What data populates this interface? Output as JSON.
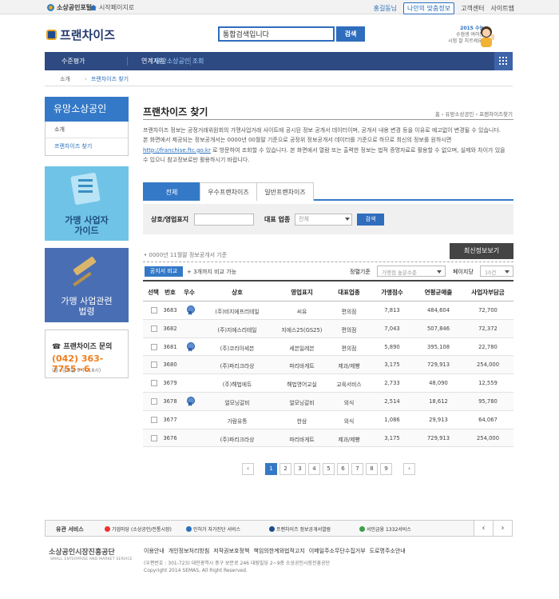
{
  "topbar": {
    "portal": "소상공인포털",
    "start_page": "시작페이지로",
    "lang": "홍길동님",
    "custom_info": "나만의 맞춤정보",
    "support": "고객센터",
    "sitemap": "사이트맵"
  },
  "header": {
    "brand": "프랜차이즈",
    "search_value": "통합검색입니다",
    "search_button": "검색",
    "promo_year": "2015 수능",
    "promo_l2": "수험생 여러분",
    "promo_l3": "시험 잘 치르세요!"
  },
  "nav": {
    "items": [
      "수준평가",
      "연계지원",
      "유망소상공인 조회"
    ]
  },
  "crumb": {
    "home": "소개",
    "current": "프랜차이즈 찾기"
  },
  "sidebar": {
    "title": "유망소상공인",
    "items": [
      "소개",
      "프랜차이즈 찾기"
    ],
    "banner1_l1": "가맹 사업자",
    "banner1_l2": "가이드",
    "banner2_l1": "가맹 사업관련",
    "banner2_l2": "법령",
    "contact_title": "프랜차이즈 문의",
    "contact_phone": "(042) 363-7755~6",
    "contact_hours": "(월~금요일 9시~18시)"
  },
  "page": {
    "title": "프랜차이즈 찾기",
    "location": "홈 › 유망소상공인 › 프랜차이즈찾기",
    "desc_1": "프랜차이즈 정보는 공정거래위원회의 가맹사업거래 사이트에 공시된 정보 공개서 데이터이며, 공개서 내용 변경 등을 이유로 예고없이 변경될 수 있습니다.  본 화면에서 제공되는 정보공개서는 0000년 00월말 기준으로 공정위 정보공개서 데이터를 기준으로 하므로 최신의 정보를 원하시면 ",
    "desc_link": "http://franchise.ftc.go.kr",
    "desc_2": " 로 방문하여 조회할 수 있습니다. 본 화면에서 열람 또는 출력한 정보는 법적 증명자료로 활용할 수 없으며, 실제와 차이가 있을 수 있으니 참고정보로만 활용하시기 바랍니다."
  },
  "tabs": [
    "전체",
    "우수프랜차이즈",
    "일반프랜차이즈"
  ],
  "filter": {
    "name_label": "상호/영업표지",
    "name_value": "",
    "industry_label": "대표 업종",
    "industry_value": "전체",
    "search_button": "검색"
  },
  "list": {
    "basis": "0000년 11월말 정보공개서 기준",
    "latest_button": "최신정보보기",
    "compare_button": "공지서 비교",
    "compare_note": "+ 3개까지 비교 가능",
    "sort_label": "정렬기준",
    "sort_value": "가맹점 높은수준",
    "page_label": "페이지당",
    "page_value": "10건",
    "columns": [
      "선택",
      "번호",
      "우수",
      "상호",
      "영업표지",
      "대표업종",
      "가맹점수",
      "연평균매출",
      "사업자부담금"
    ],
    "rows": [
      {
        "no": "3683",
        "star": true,
        "company": "(주)비지에프리테일",
        "brand": "씨유",
        "industry": "편의점",
        "stores": "7,813",
        "sales": "484,604",
        "cost": "72,700"
      },
      {
        "no": "3682",
        "star": false,
        "company": "(주)지에스리테일",
        "brand": "지에스25(GS25)",
        "industry": "편의점",
        "stores": "7,043",
        "sales": "507,846",
        "cost": "72,372"
      },
      {
        "no": "3681",
        "star": true,
        "company": "(주)코리아세븐",
        "brand": "세븐일레븐",
        "industry": "편의점",
        "stores": "5,890",
        "sales": "395,108",
        "cost": "22,780"
      },
      {
        "no": "3680",
        "star": false,
        "company": "(주)파리크라상",
        "brand": "파리바게트",
        "industry": "제과/제빵",
        "stores": "3,175",
        "sales": "729,913",
        "cost": "254,000"
      },
      {
        "no": "3679",
        "star": false,
        "company": "(주)해법에듀",
        "brand": "해법영어교실",
        "industry": "교육서비스",
        "stores": "2,733",
        "sales": "48,090",
        "cost": "12,559"
      },
      {
        "no": "3678",
        "star": true,
        "company": "얼모닝갈비",
        "brand": "얼모닝갈비",
        "industry": "외식",
        "stores": "2,514",
        "sales": "18,612",
        "cost": "95,780"
      },
      {
        "no": "3677",
        "star": false,
        "company": "가람유통",
        "brand": "한삼",
        "industry": "외식",
        "stores": "1,086",
        "sales": "29,913",
        "cost": "64,067"
      },
      {
        "no": "3676",
        "star": false,
        "company": "(주)파리크라상",
        "brand": "파리바게트",
        "industry": "제과/제빵",
        "stores": "3,175",
        "sales": "729,913",
        "cost": "254,000"
      }
    ]
  },
  "pager": {
    "prev": "‹",
    "next": "›",
    "pages": [
      "1",
      "2",
      "3",
      "4",
      "5",
      "6",
      "7",
      "8",
      "9"
    ]
  },
  "footer": {
    "svc_label": "유관 서비스",
    "svc": [
      "기업마당 (소상공인/전통시장)",
      "인허가 자가진단 서비스",
      "프랜차이즈 정보공개서열람",
      "서민금융 1332서비스"
    ],
    "logo": "소상공인시장진흥공단",
    "logo_sub": "SMALL ENTERPRISE AND MARKET SERVICE",
    "links": [
      "이용안내",
      "개인정보처리방침",
      "저작권보호정책",
      "책임의한계와법적고지",
      "이메일주소무단수집거부",
      "도로명주소안내"
    ],
    "address": "(우편번호 : 301-723) 대전광역시 중구 보문로 246 대림빌딩 2~9층 소상공인시장진흥공단",
    "copyright": "Copyright 2014 SEMAS, All Right Reserved."
  }
}
